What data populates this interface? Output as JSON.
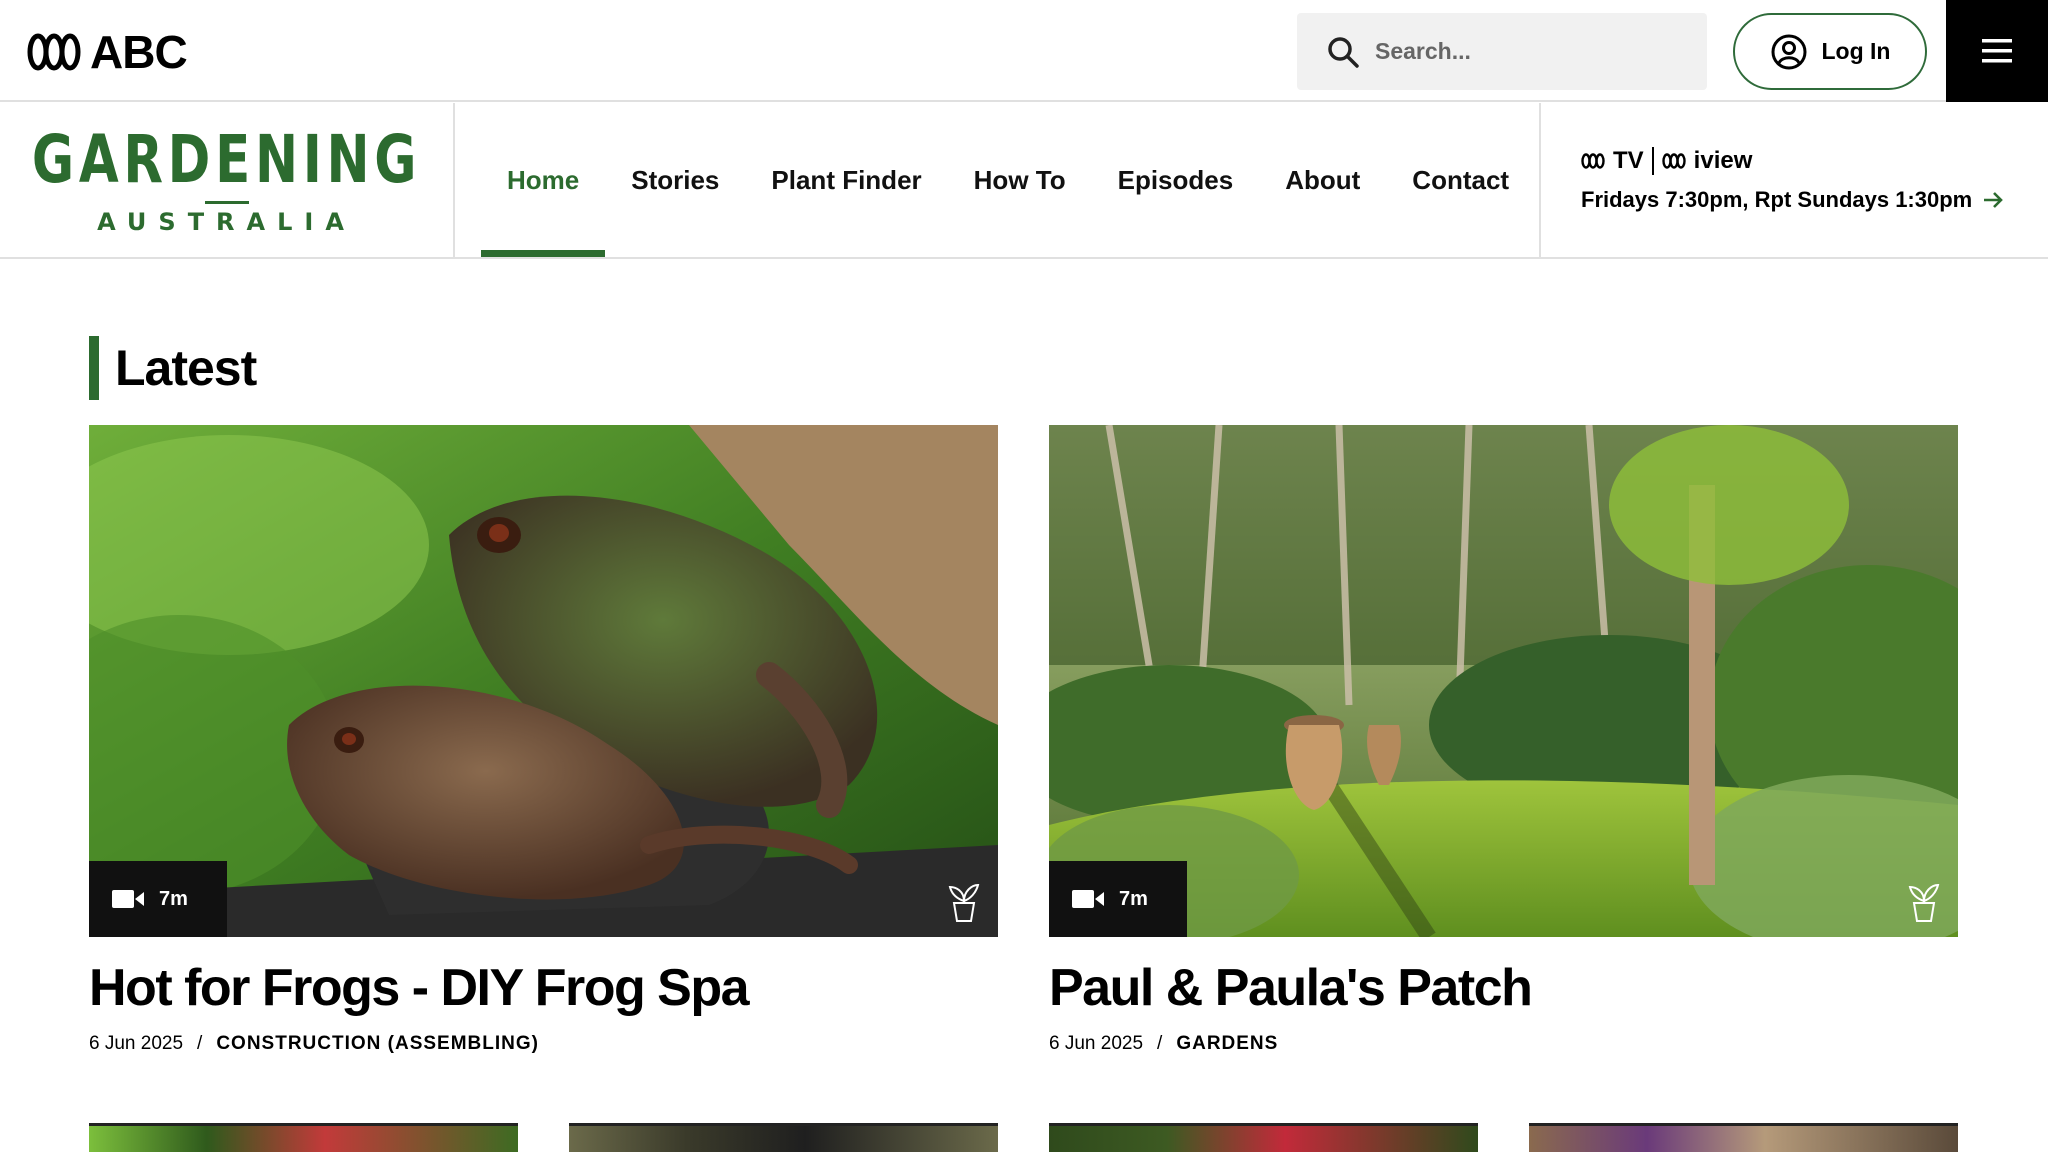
{
  "header": {
    "brand": "ABC",
    "search_placeholder": "Search...",
    "login_label": "Log In",
    "menu_icon": "hamburger-icon"
  },
  "program": {
    "logo_line1": "GARDENING",
    "logo_line2": "AUSTRALIA",
    "nav": [
      {
        "label": "Home",
        "active": true
      },
      {
        "label": "Stories"
      },
      {
        "label": "Plant Finder"
      },
      {
        "label": "How To"
      },
      {
        "label": "Episodes"
      },
      {
        "label": "About"
      },
      {
        "label": "Contact"
      }
    ],
    "airtime": {
      "brand_tv": "TV",
      "brand_iview": "iview",
      "schedule": "Fridays 7:30pm, Rpt Sundays 1:30pm"
    }
  },
  "section": {
    "title": "Latest"
  },
  "cards": [
    {
      "title": "Hot for Frogs - DIY Frog Spa",
      "duration": "7m",
      "date": "6 Jun 2025",
      "separator": "/",
      "tag": "CONSTRUCTION (ASSEMBLING)"
    },
    {
      "title": "Paul & Paula's Patch",
      "duration": "7m",
      "date": "6 Jun 2025",
      "separator": "/",
      "tag": "GARDENS"
    }
  ],
  "colors": {
    "brand_green": "#2c6b2f",
    "text": "#000000",
    "divider": "#e0e0e0"
  }
}
